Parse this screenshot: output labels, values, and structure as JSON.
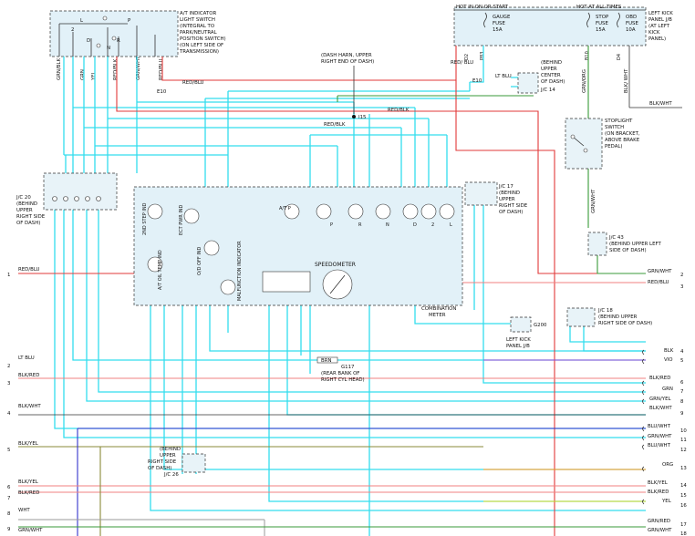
{
  "switch_box": {
    "title": [
      "A/T INDICATOR",
      "LIGHT SWITCH",
      "(INTEGRAL TO",
      "PARK/NEUTRAL",
      "POSITION SWITCH)",
      "(ON LEFT SIDE OF",
      "TRANSMISSION)"
    ],
    "positions": [
      "L",
      "P",
      "2",
      "D",
      "R",
      "N"
    ]
  },
  "fuse_panel": {
    "hot_run_start": "HOT IN ON OR START",
    "hot_all_times": "HOT AT ALL TIMES",
    "gauge_fuse": [
      "GAUGE",
      "FUSE",
      "15A"
    ],
    "stop_fuse": [
      "STOP",
      "FUSE",
      "15A"
    ],
    "obd_fuse": [
      "OBD",
      "FUSE",
      "10A"
    ],
    "panel_label": [
      "LEFT KICK",
      "PANEL J/B",
      "(AT LEFT",
      "KICK",
      "PANEL)"
    ],
    "pins": [
      "D2",
      "P83",
      "B10",
      "D4"
    ]
  },
  "switch_wires": [
    "GRN/BLK",
    "GRN",
    "YEL",
    "RED/BLK",
    "GRN/WHT",
    "RED/BLU"
  ],
  "splice_dash": [
    "(DASH HARN, UPPER",
    "RIGHT END OF DASH)"
  ],
  "labels": {
    "e10_a": "E10",
    "e10_b": "E10",
    "red_blu": "RED/BLU",
    "red_blk": "RED/BLK",
    "red_blk2": "RED/BLK",
    "i15": "I15",
    "red_blu_v": "RED/ BLU",
    "lt_blu": "LT BLU",
    "jc14": [
      "(BEHIND",
      "UPPER",
      "CENTER",
      "OF DASH)"
    ],
    "jc14_tag": "J/C 14",
    "grn_org": "GRN/ORG",
    "blk_wht": "BLK/ WHT",
    "blk_wht_h": "BLK/WHT",
    "stoplight": [
      "STOPLIGHT",
      "SWITCH",
      "(ON BRACKET,",
      "ABOVE BRAKE",
      "PEDAL)"
    ],
    "grn_wht_v": "GRN/WHT",
    "jc43": [
      "J/C 43",
      "(BEHIND UPPER LEFT",
      "SIDE OF DASH)"
    ],
    "jc20": [
      "J/C 20",
      "(BEHIND",
      "UPPER",
      "RIGHT SIDE",
      "OF DASH)"
    ],
    "jc17": [
      "J/C 17",
      "(BEHIND",
      "UPPER",
      "RIGHT SIDE",
      "OF DASH)"
    ],
    "jc18": [
      "J/C 18",
      "(BEHIND UPPER",
      "RIGHT SIDE OF DASH)"
    ],
    "jc26": [
      "(BEHIND",
      "UPPER",
      "RIGHT SIDE",
      "OF DASH)",
      "J/C 26"
    ],
    "g200": "G200",
    "left_kick": [
      "LEFT KICK",
      "PANEL J/B"
    ],
    "g117": [
      "G117",
      "(REAR BANK OF",
      "RIGHT CYL HEAD)"
    ],
    "brn": "BRN",
    "combination_meter": [
      "COMBINATION",
      "METER"
    ],
    "speedometer": "SPEEDOMETER",
    "cluster_items": [
      "2ND STEP IND",
      "A/T OIL TEMP IND",
      "ECT PWR IND",
      "O/D OFF IND",
      "MALFUNCTION INDICATOR",
      "A/T P",
      "P",
      "R",
      "N",
      "D",
      "2",
      "L"
    ]
  },
  "left_connectors": [
    {
      "num": "1",
      "label": "RED/BLU"
    },
    {
      "num": "2",
      "label": "LT BLU"
    },
    {
      "num": "3",
      "label": "BLK/RED"
    },
    {
      "num": "4",
      "label": "BLK/WHT"
    },
    {
      "num": "5",
      "label": "BLK/YEL"
    },
    {
      "num": "6",
      "label": "BLK/YEL"
    },
    {
      "num": "7",
      "label": "BLK/RED"
    },
    {
      "num": "8",
      "label": "WHT"
    },
    {
      "num": "9",
      "label": "GRN/WHT"
    }
  ],
  "right_connectors": [
    {
      "num": "2",
      "label": "GRN/WHT"
    },
    {
      "num": "3",
      "label": "RED/BLU"
    },
    {
      "num": "4",
      "label": "BLK"
    },
    {
      "num": "5",
      "label": "VIO"
    },
    {
      "num": "6",
      "label": "BLK/RED"
    },
    {
      "num": "7",
      "label": "GRN"
    },
    {
      "num": "8",
      "label": "GRN/YEL"
    },
    {
      "num": "9",
      "label": "BLK/WHT"
    },
    {
      "num": "10",
      "label": "BLU/WHT"
    },
    {
      "num": "11",
      "label": "GRN/WHT"
    },
    {
      "num": "12",
      "label": "BLU/WHT"
    },
    {
      "num": "13",
      "label": "ORG"
    },
    {
      "num": "14",
      "label": "BLK/YEL"
    },
    {
      "num": "15",
      "label": "BLK/RED"
    },
    {
      "num": "16",
      "label": "YEL"
    },
    {
      "num": "17",
      "label": "GRN/RED"
    },
    {
      "num": "18",
      "label": "GRN/WHT"
    }
  ],
  "colors": {
    "cyan": "#33ddee",
    "red": "#e23a3a",
    "green": "#3a9a3a",
    "blue": "#3333cc",
    "purple": "#9b4bd6"
  }
}
